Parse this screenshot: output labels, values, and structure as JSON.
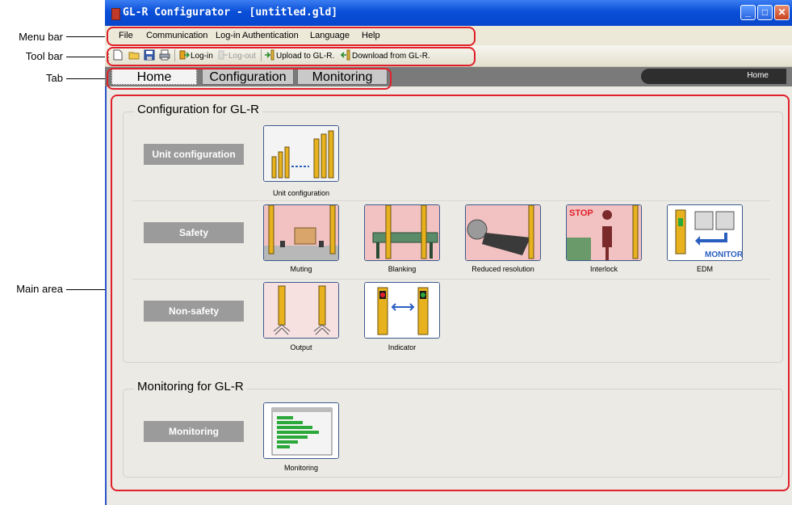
{
  "callouts": {
    "menu_bar": "Menu bar",
    "tool_bar": "Tool bar",
    "tab": "Tab",
    "main_area": "Main area"
  },
  "window": {
    "title": "GL-R Configurator - [untitled.gld]",
    "controls": [
      "minimize",
      "maximize",
      "close"
    ]
  },
  "menu": [
    "File",
    "Communication",
    "Log-in Authentication",
    "Language",
    "Help"
  ],
  "toolbar": {
    "login": "Log-in",
    "logout": "Log-out",
    "upload": "Upload to GL-R.",
    "download": "Download from GL-R."
  },
  "tabs": {
    "home": "Home",
    "configuration": "Configuration",
    "monitoring": "Monitoring"
  },
  "breadcrumb": "Home",
  "config_section": {
    "title": "Configuration for GL-R",
    "unit_category": "Unit configuration",
    "unit_items": [
      "Unit configuration"
    ],
    "safety_category": "Safety",
    "safety_items": [
      "Muting",
      "Blanking",
      "Reduced resolution",
      "Interlock",
      "EDM"
    ],
    "nonsafety_category": "Non-safety",
    "nonsafety_items": [
      "Output",
      "Indicator"
    ]
  },
  "monitor_section": {
    "title": "Monitoring for GL-R",
    "category": "Monitoring",
    "items": [
      "Monitoring"
    ]
  },
  "icon_texts": {
    "stop": "STOP",
    "monitor": "MONITOR"
  },
  "colors": {
    "title_bar": "#0a4fd8",
    "highlight": "#e0202a",
    "category_bg": "#9b9b9b"
  }
}
